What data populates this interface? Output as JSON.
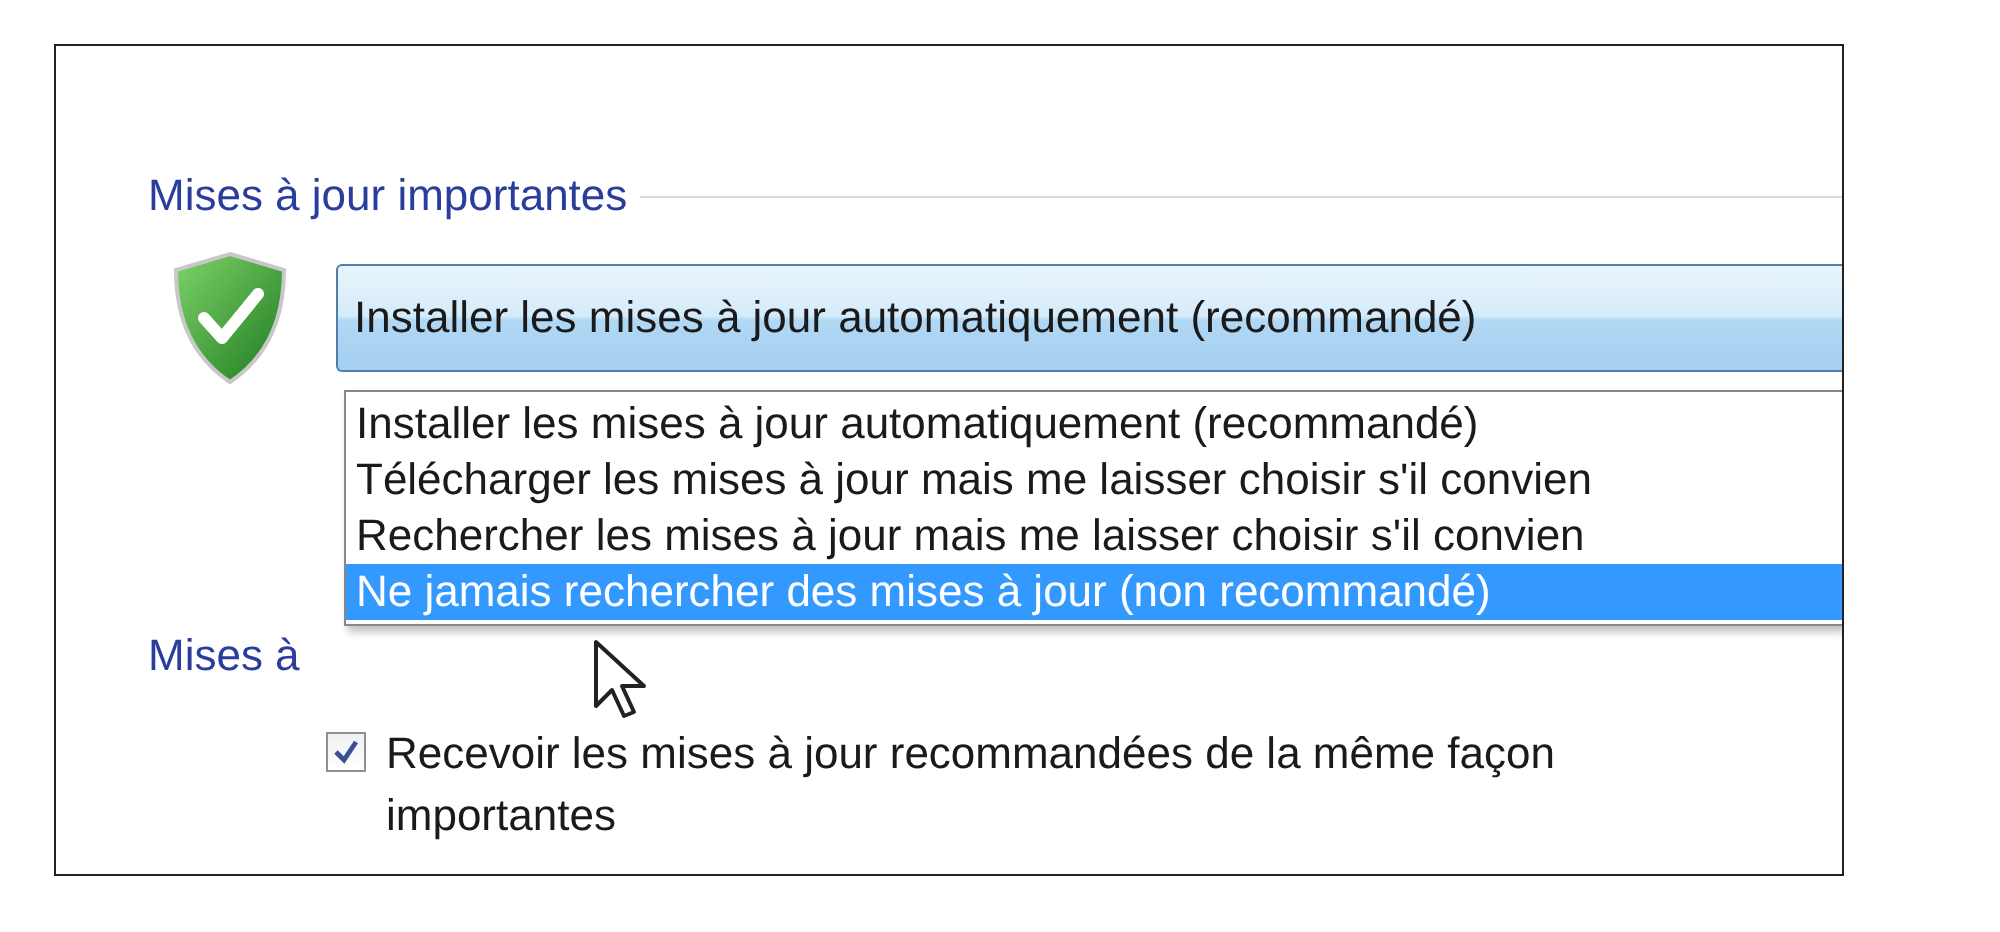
{
  "important_group": {
    "title": "Mises à jour importantes"
  },
  "update_combo": {
    "value": "Installer les mises à jour automatiquement (recommandé)",
    "expanded": true
  },
  "options": [
    {
      "label": "Installer les mises à jour automatiquement (recommandé)",
      "selected": false
    },
    {
      "label": "Télécharger les mises à jour mais me laisser choisir s'il convien",
      "selected": false
    },
    {
      "label": "Rechercher les mises à jour mais me laisser choisir s'il convien",
      "selected": false
    },
    {
      "label": "Ne jamais rechercher des mises à jour (non recommandé)",
      "selected": true
    }
  ],
  "recommended_group": {
    "title": "Mises à"
  },
  "recommended_checkbox": {
    "checked": true,
    "label_lines": [
      "Recevoir les mises à jour recommandées de la même façon",
      "importantes"
    ]
  }
}
